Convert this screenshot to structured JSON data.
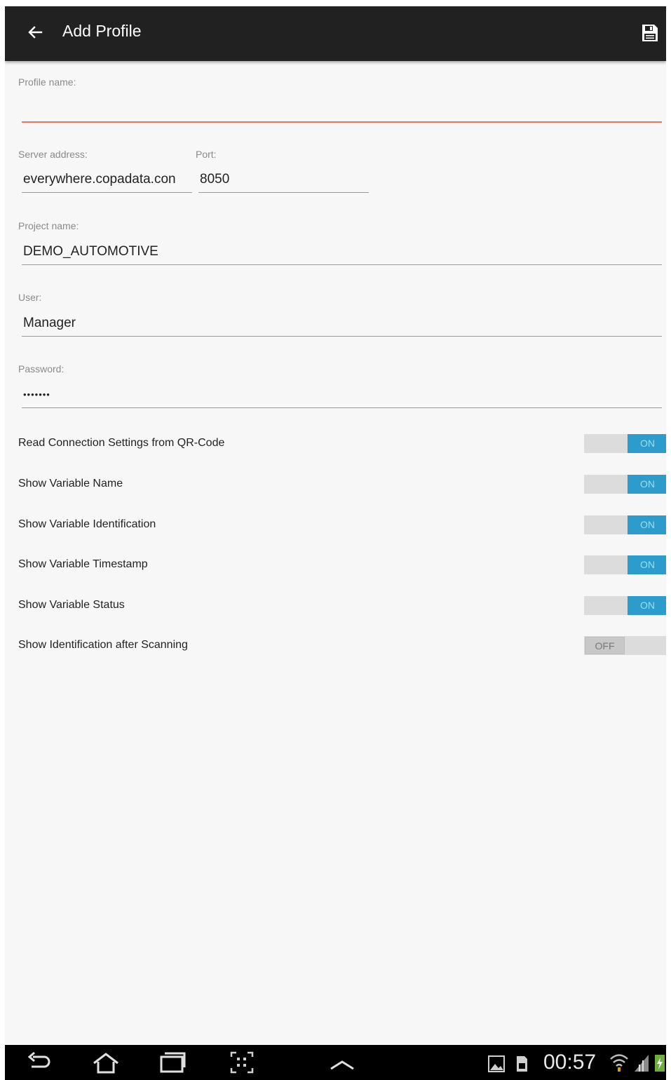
{
  "appbar": {
    "title": "Add Profile"
  },
  "form": {
    "profile_name_label": "Profile name:",
    "profile_name_value": "",
    "server_address_label": "Server address:",
    "server_address_value": "everywhere.copadata.con",
    "port_label": "Port:",
    "port_value": "8050",
    "project_name_label": "Project name:",
    "project_name_value": "DEMO_AUTOMOTIVE",
    "user_label": "User:",
    "user_value": "Manager",
    "password_label": "Password:",
    "password_value": "•••••••"
  },
  "toggles": [
    {
      "label": "Read Connection Settings from QR-Code",
      "state": "ON"
    },
    {
      "label": "Show Variable Name",
      "state": "ON"
    },
    {
      "label": "Show Variable Identification",
      "state": "ON"
    },
    {
      "label": "Show Variable Timestamp",
      "state": "ON"
    },
    {
      "label": "Show Variable Status",
      "state": "ON"
    },
    {
      "label": "Show Identification after Scanning",
      "state": "OFF"
    }
  ],
  "statusbar": {
    "time": "00:57"
  },
  "colors": {
    "appbar_bg": "#212121",
    "switch_on": "#2c9ccc",
    "focus_underline": "#f07360"
  },
  "icons": [
    "back-arrow-icon",
    "save-icon",
    "nav-back-icon",
    "nav-home-icon",
    "nav-recents-icon",
    "screenshot-icon",
    "nav-up-icon",
    "gallery-icon",
    "sd-card-icon",
    "wifi-icon",
    "signal-icon",
    "battery-icon"
  ]
}
